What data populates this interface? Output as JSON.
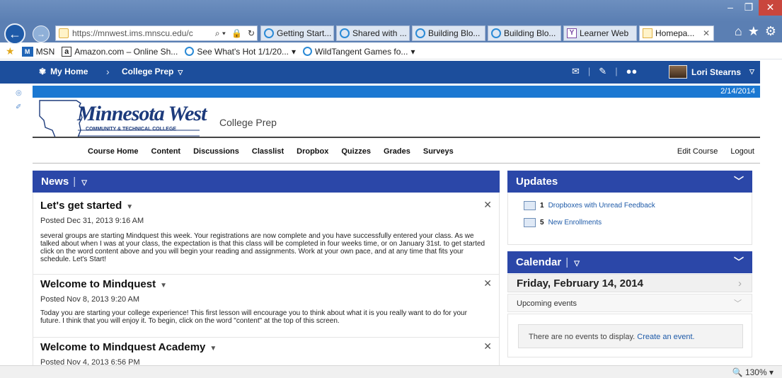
{
  "browser": {
    "address": "https://mnwest.ims.mnscu.edu/c",
    "tabs": [
      {
        "label": "Getting Start...",
        "icon": "ie"
      },
      {
        "label": "Shared with ...",
        "icon": "ie"
      },
      {
        "label": "Building Blo...",
        "icon": "ie"
      },
      {
        "label": "Building Blo...",
        "icon": "ie"
      },
      {
        "label": "Learner Web",
        "icon": "y"
      },
      {
        "label": "Homepa...",
        "icon": "doc",
        "active": true
      }
    ],
    "favorites": [
      {
        "label": "MSN"
      },
      {
        "label": "Amazon.com – Online Sh..."
      },
      {
        "label": "See What's Hot 1/1/20..."
      },
      {
        "label": "WildTangent Games fo..."
      }
    ],
    "zoom": "130%"
  },
  "topnav": {
    "home_label": "My Home",
    "course_label": "College Prep",
    "user_name": "Lori Stearns"
  },
  "site": {
    "date": "2/14/2014",
    "logo_main": "Minnesota West",
    "logo_sub": "COMMUNITY & TECHNICAL COLLEGE",
    "course_title": "College Prep"
  },
  "coursenav": {
    "links": [
      "Course Home",
      "Content",
      "Discussions",
      "Classlist",
      "Dropbox",
      "Quizzes",
      "Grades",
      "Surveys"
    ],
    "edit": "Edit Course",
    "logout": "Logout"
  },
  "news": {
    "title": "News",
    "items": [
      {
        "title": "Let's get started",
        "posted": "Posted Dec 31, 2013 9:16 AM",
        "body": "several groups are starting Mindquest this week.  Your registrations are now complete and you have successfully entered your class.  As we talked about when I was at your class, the expectation is that this class will be completed in four weeks time, or on January 31st. to get started click on the word content above and you will begin your reading and assignments. Work at your own pace, and at any time that fits your schedule.  Let's Start!"
      },
      {
        "title": "Welcome to Mindquest",
        "posted": "Posted Nov 8, 2013 9:20 AM",
        "body": "Today you are starting your college experience! This first lesson will encourage you to think about what it is you really want to do for your future.  I think that you will enjoy it.  To begin, click on the word \"content\" at the top of this screen."
      },
      {
        "title": "Welcome to Mindquest Academy",
        "posted": "Posted Nov 4, 2013 6:56 PM",
        "body": ""
      }
    ]
  },
  "updates": {
    "title": "Updates",
    "items": [
      {
        "count": "1",
        "label": "Dropboxes with Unread Feedback"
      },
      {
        "count": "5",
        "label": "New Enrollments"
      }
    ]
  },
  "calendar": {
    "title": "Calendar",
    "date": "Friday, February 14, 2014",
    "upcoming": "Upcoming events",
    "empty": "There are no events to display.",
    "create": "Create an event."
  }
}
